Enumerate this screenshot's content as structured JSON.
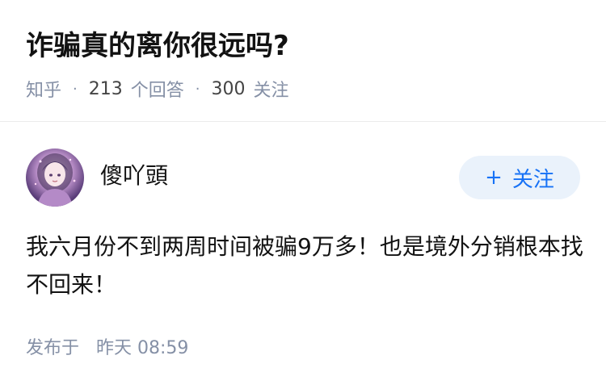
{
  "question": {
    "title": "诈骗真的离你很远吗?",
    "source": "知乎",
    "answer_count": "213",
    "answer_label": "个回答",
    "follower_count": "300",
    "follower_label": "关注",
    "separator": "·"
  },
  "answer": {
    "author": {
      "name": "傻吖頭",
      "avatar_icon": "avatar-portrait-icon"
    },
    "follow_button": {
      "icon": "plus-icon",
      "icon_glyph": "+",
      "label": "关注"
    },
    "content": "我六月份不到两周时间被骗9万多！也是境外分销根本找不回来！",
    "published_label": "发布于",
    "published_time": "昨天 08:59"
  },
  "colors": {
    "accent": "#1772f6",
    "follow_bg": "#eaf2fb",
    "meta_text": "#8590a6",
    "primary_text": "#121212"
  }
}
